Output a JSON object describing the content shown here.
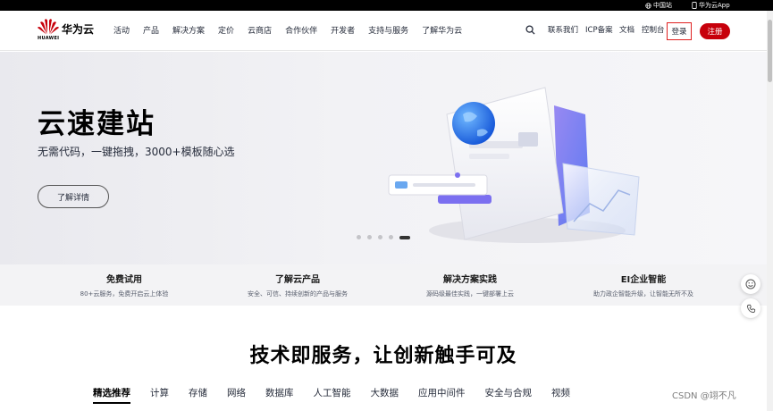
{
  "topbar": {
    "region": "中国站",
    "app": "华为云App"
  },
  "brand": {
    "logo_word": "HUAWEI",
    "name": "华为云",
    "red": "#c7000b"
  },
  "nav": {
    "links": [
      "活动",
      "产品",
      "解决方案",
      "定价",
      "云商店",
      "合作伙伴",
      "开发者",
      "支持与服务",
      "了解华为云"
    ],
    "contact": "联系我们",
    "icp": "ICP备案",
    "docs": "文档",
    "console": "控制台",
    "login": "登录",
    "register": "注册"
  },
  "hero": {
    "title": "云速建站",
    "subtitle": "无需代码，一键拖拽，3000+模板随心选",
    "button": "了解详情",
    "slide_count": 5,
    "active_slide": 5
  },
  "features": [
    {
      "title": "免费试用",
      "desc": "80+云服务，免费开启云上体验"
    },
    {
      "title": "了解云产品",
      "desc": "安全、可信、持续创新的产品与服务"
    },
    {
      "title": "解决方案实践",
      "desc": "源码级最佳实践，一键部署上云"
    },
    {
      "title": "EI企业智能",
      "desc": "助力政企智能升级，让智能无所不及"
    }
  ],
  "section": {
    "title": "技术即服务，让创新触手可及",
    "tabs": [
      "精选推荐",
      "计算",
      "存储",
      "网络",
      "数据库",
      "人工智能",
      "大数据",
      "应用中间件",
      "安全与合规",
      "视频"
    ],
    "active_tab": "精选推荐"
  },
  "icons": {
    "search": "search-icon",
    "globe": "globe-icon",
    "phone_app": "mobile-icon",
    "feedback": "smile-icon",
    "contact": "phone-icon"
  },
  "watermark": "CSDN @翊不凡"
}
